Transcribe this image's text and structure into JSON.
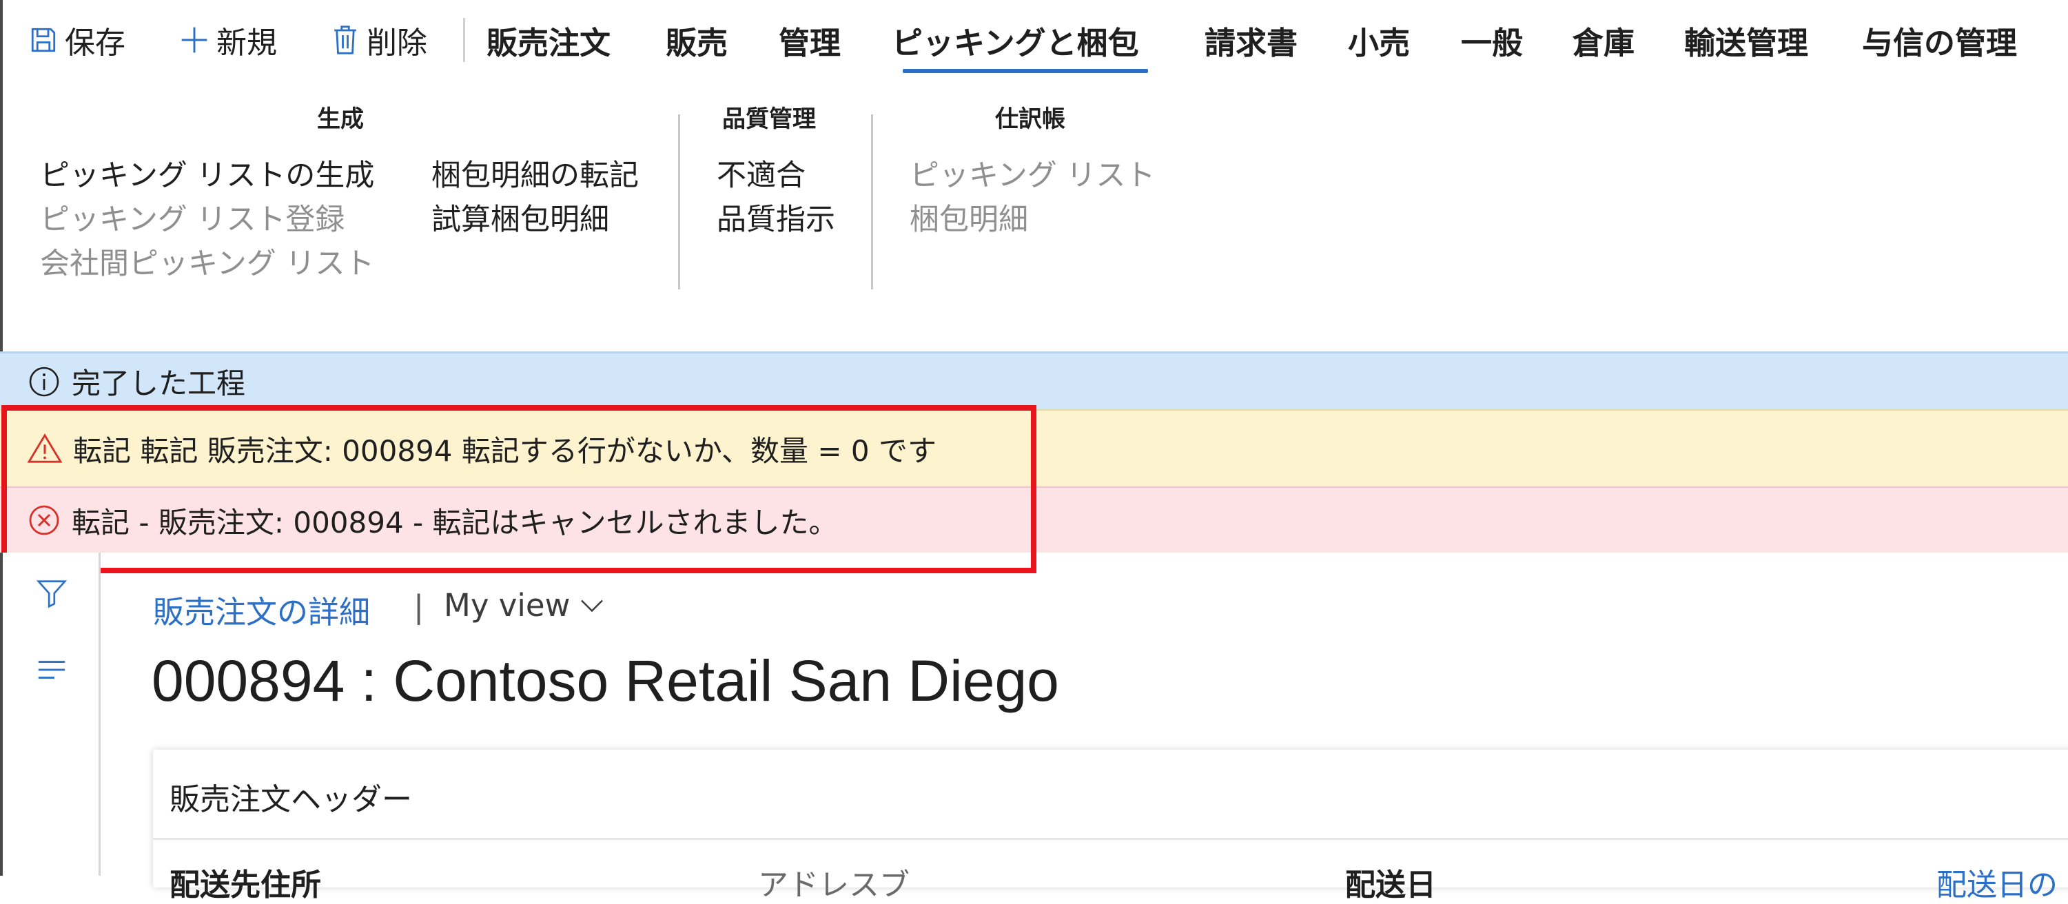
{
  "toolbar": {
    "save_label": "保存",
    "new_label": "新規",
    "delete_label": "削除"
  },
  "tabs": [
    {
      "label": "販売注文"
    },
    {
      "label": "販売"
    },
    {
      "label": "管理"
    },
    {
      "label": "ピッキングと梱包",
      "active": true
    },
    {
      "label": "請求書"
    },
    {
      "label": "小売"
    },
    {
      "label": "一般"
    },
    {
      "label": "倉庫"
    },
    {
      "label": "輸送管理"
    },
    {
      "label": "与信の管理"
    }
  ],
  "ribbon": {
    "generate": {
      "title": "生成",
      "items": [
        {
          "label": "ピッキング リストの生成",
          "enabled": true
        },
        {
          "label": "ピッキング リスト登録",
          "enabled": false
        },
        {
          "label": "会社間ピッキング リスト",
          "enabled": false
        },
        {
          "label": "梱包明細の転記",
          "enabled": true
        },
        {
          "label": "試算梱包明細",
          "enabled": true
        }
      ]
    },
    "quality": {
      "title": "品質管理",
      "items": [
        {
          "label": "不適合",
          "enabled": true
        },
        {
          "label": "品質指示",
          "enabled": true
        }
      ]
    },
    "journal": {
      "title": "仕訳帳",
      "items": [
        {
          "label": "ピッキング リスト",
          "enabled": false
        },
        {
          "label": "梱包明細",
          "enabled": false
        }
      ]
    }
  },
  "messages": {
    "info": "完了した工程",
    "warning": "転記  転記 販売注文: 000894 転記する行がないか、数量 = 0 です",
    "error": "転記 - 販売注文: 000894 - 転記はキャンセルされました。"
  },
  "content": {
    "breadcrumb_link": "販売注文の詳細",
    "breadcrumb_sep": "|",
    "view_label": "My view",
    "title": "000894 : Contoso Retail San Diego",
    "section_title": "販売注文ヘッダー",
    "columns": [
      "配送先住所",
      "アドレスブ",
      "配送日",
      "配送日の"
    ]
  },
  "colors": {
    "accent": "#2b6fc6",
    "info_bg": "#d2e6fa",
    "warning_bg": "#fdf3cf",
    "error_bg": "#fde3e6",
    "highlight_border": "#e8141c"
  }
}
